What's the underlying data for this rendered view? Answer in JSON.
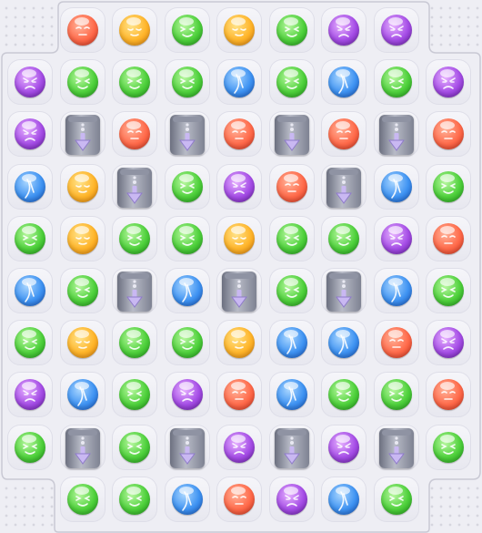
{
  "board": {
    "columns": 9,
    "rows": 10,
    "grid": [
      [
        "void",
        "red",
        "yellow",
        "green",
        "yellow",
        "green",
        "purple",
        "purple",
        "void"
      ],
      [
        "purple",
        "green",
        "green",
        "green",
        "blue",
        "green",
        "blue",
        "green",
        "purple"
      ],
      [
        "purple",
        "drop",
        "red",
        "drop",
        "red",
        "drop",
        "red",
        "drop",
        "red"
      ],
      [
        "blue",
        "yellow",
        "drop",
        "green",
        "purple",
        "red",
        "drop",
        "blue",
        "green"
      ],
      [
        "green",
        "yellow",
        "green",
        "green",
        "yellow",
        "green",
        "green",
        "purple",
        "red"
      ],
      [
        "blue",
        "green",
        "drop",
        "blue",
        "drop",
        "green",
        "drop",
        "blue",
        "green"
      ],
      [
        "green",
        "yellow",
        "green",
        "green",
        "yellow",
        "blue",
        "blue",
        "red",
        "purple"
      ],
      [
        "purple",
        "blue",
        "green",
        "purple",
        "red",
        "blue",
        "green",
        "green",
        "red"
      ],
      [
        "green",
        "drop",
        "green",
        "drop",
        "purple",
        "drop",
        "purple",
        "drop",
        "green"
      ],
      [
        "void",
        "green",
        "green",
        "blue",
        "red",
        "purple",
        "blue",
        "green",
        "void"
      ]
    ]
  },
  "piece_colors": {
    "red": "#ff6a4a",
    "yellow": "#ffb52a",
    "green": "#4fd13c",
    "blue": "#3f93f2",
    "purple": "#a54de6",
    "drop": "#9aa0b0"
  },
  "icons": {
    "drop": "down-arrow-pillar-icon",
    "orb": "face-orb-icon"
  }
}
